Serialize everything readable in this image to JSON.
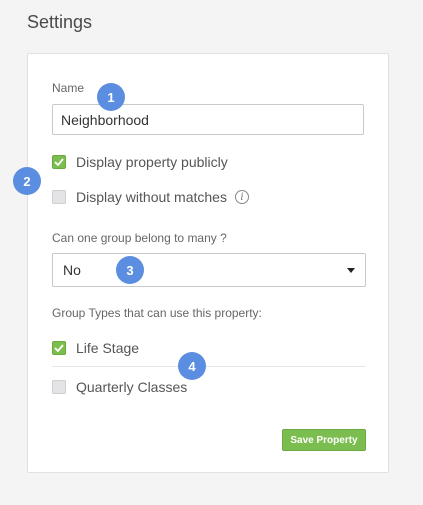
{
  "page": {
    "title": "Settings"
  },
  "form": {
    "name_label": "Name",
    "name_value": "Neighborhood",
    "display_publicly": {
      "label": "Display property publicly",
      "checked": true
    },
    "display_without_matches": {
      "label": "Display without matches",
      "checked": false,
      "info_icon": "info-icon"
    },
    "belong_to_many": {
      "label": "Can one group belong to many ?",
      "selected": "No"
    },
    "group_types": {
      "label": "Group Types that can use this property:",
      "items": [
        {
          "label": "Life Stage",
          "checked": true
        },
        {
          "label": "Quarterly Classes",
          "checked": false
        }
      ]
    },
    "save_label": "Save Property"
  },
  "annotations": [
    "1",
    "2",
    "3",
    "4"
  ],
  "colors": {
    "accent_green": "#7bbd4f",
    "badge_blue": "#5b8ee0"
  }
}
